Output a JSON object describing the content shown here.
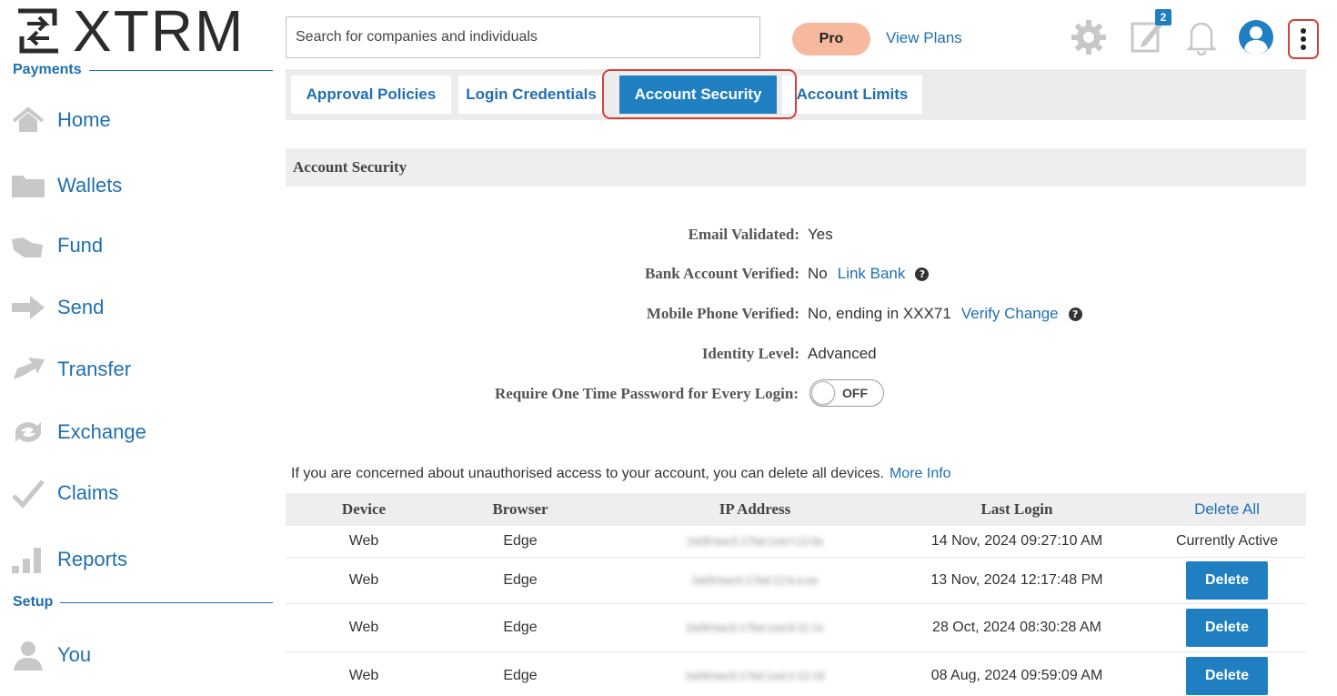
{
  "brand": {
    "name": "XTRM"
  },
  "sidebar": {
    "payments_label": "Payments",
    "setup_label": "Setup",
    "items": [
      {
        "label": "Home",
        "icon": "home-icon"
      },
      {
        "label": "Wallets",
        "icon": "folder-icon"
      },
      {
        "label": "Fund",
        "icon": "fund-icon"
      },
      {
        "label": "Send",
        "icon": "send-arrow-icon"
      },
      {
        "label": "Transfer",
        "icon": "transfer-icon"
      },
      {
        "label": "Exchange",
        "icon": "exchange-icon"
      },
      {
        "label": "Claims",
        "icon": "checkmark-icon"
      },
      {
        "label": "Reports",
        "icon": "bar-chart-icon"
      }
    ],
    "setup_items": [
      {
        "label": "You",
        "icon": "user-icon"
      }
    ]
  },
  "header": {
    "search_placeholder": "Search for companies and individuals",
    "plan_badge": "Pro",
    "view_plans": "View Plans",
    "notification_count": "2"
  },
  "tabs": [
    {
      "label": "Approval Policies",
      "active": false
    },
    {
      "label": "Login Credentials",
      "active": false
    },
    {
      "label": "Account Security",
      "active": true
    },
    {
      "label": "Account Limits",
      "active": false
    }
  ],
  "security": {
    "section_title": "Account Security",
    "email_label": "Email Validated:",
    "email_value": "Yes",
    "bank_label": "Bank Account Verified:",
    "bank_value": "No",
    "bank_link": "Link Bank",
    "phone_label": "Mobile Phone Verified:",
    "phone_value": "No, ending in XXX71",
    "phone_link": "Verify Change",
    "identity_label": "Identity Level:",
    "identity_value": "Advanced",
    "otp_label": "Require One Time Password for Every Login:",
    "otp_state": "OFF"
  },
  "devices": {
    "notice": "If you are concerned about unauthorised access to your account, you can delete all devices.",
    "more_info": "More Info",
    "columns": {
      "device": "Device",
      "browser": "Browser",
      "ip": "IP Address",
      "last_login": "Last Login",
      "delete_all": "Delete All"
    },
    "rows": [
      {
        "device": "Web",
        "browser": "Edge",
        "ip": "2a09:bac5:17bd:1ed:f:13:3a",
        "last_login": "14 Nov, 2024 09:27:10 AM",
        "status": "Currently Active"
      },
      {
        "device": "Web",
        "browser": "Edge",
        "ip": "2a09:bac5:17bd:12:b:a:ee",
        "last_login": "13 Nov, 2024 12:17:48 PM",
        "action": "Delete"
      },
      {
        "device": "Web",
        "browser": "Edge",
        "ip": "2a09:bac5:17bd:1ed:8:11:1e",
        "last_login": "28 Oct, 2024 08:30:28 AM",
        "action": "Delete"
      },
      {
        "device": "Web",
        "browser": "Edge",
        "ip": "2a09:bac5:17bd:1ed:2:12:19",
        "last_login": "08 Aug, 2024 09:59:09 AM",
        "action": "Delete"
      }
    ]
  },
  "colors": {
    "accent": "#1f7fc1",
    "link": "#1f6fb2",
    "highlight": "#d0433a",
    "pro_badge": "#f7b99d"
  }
}
